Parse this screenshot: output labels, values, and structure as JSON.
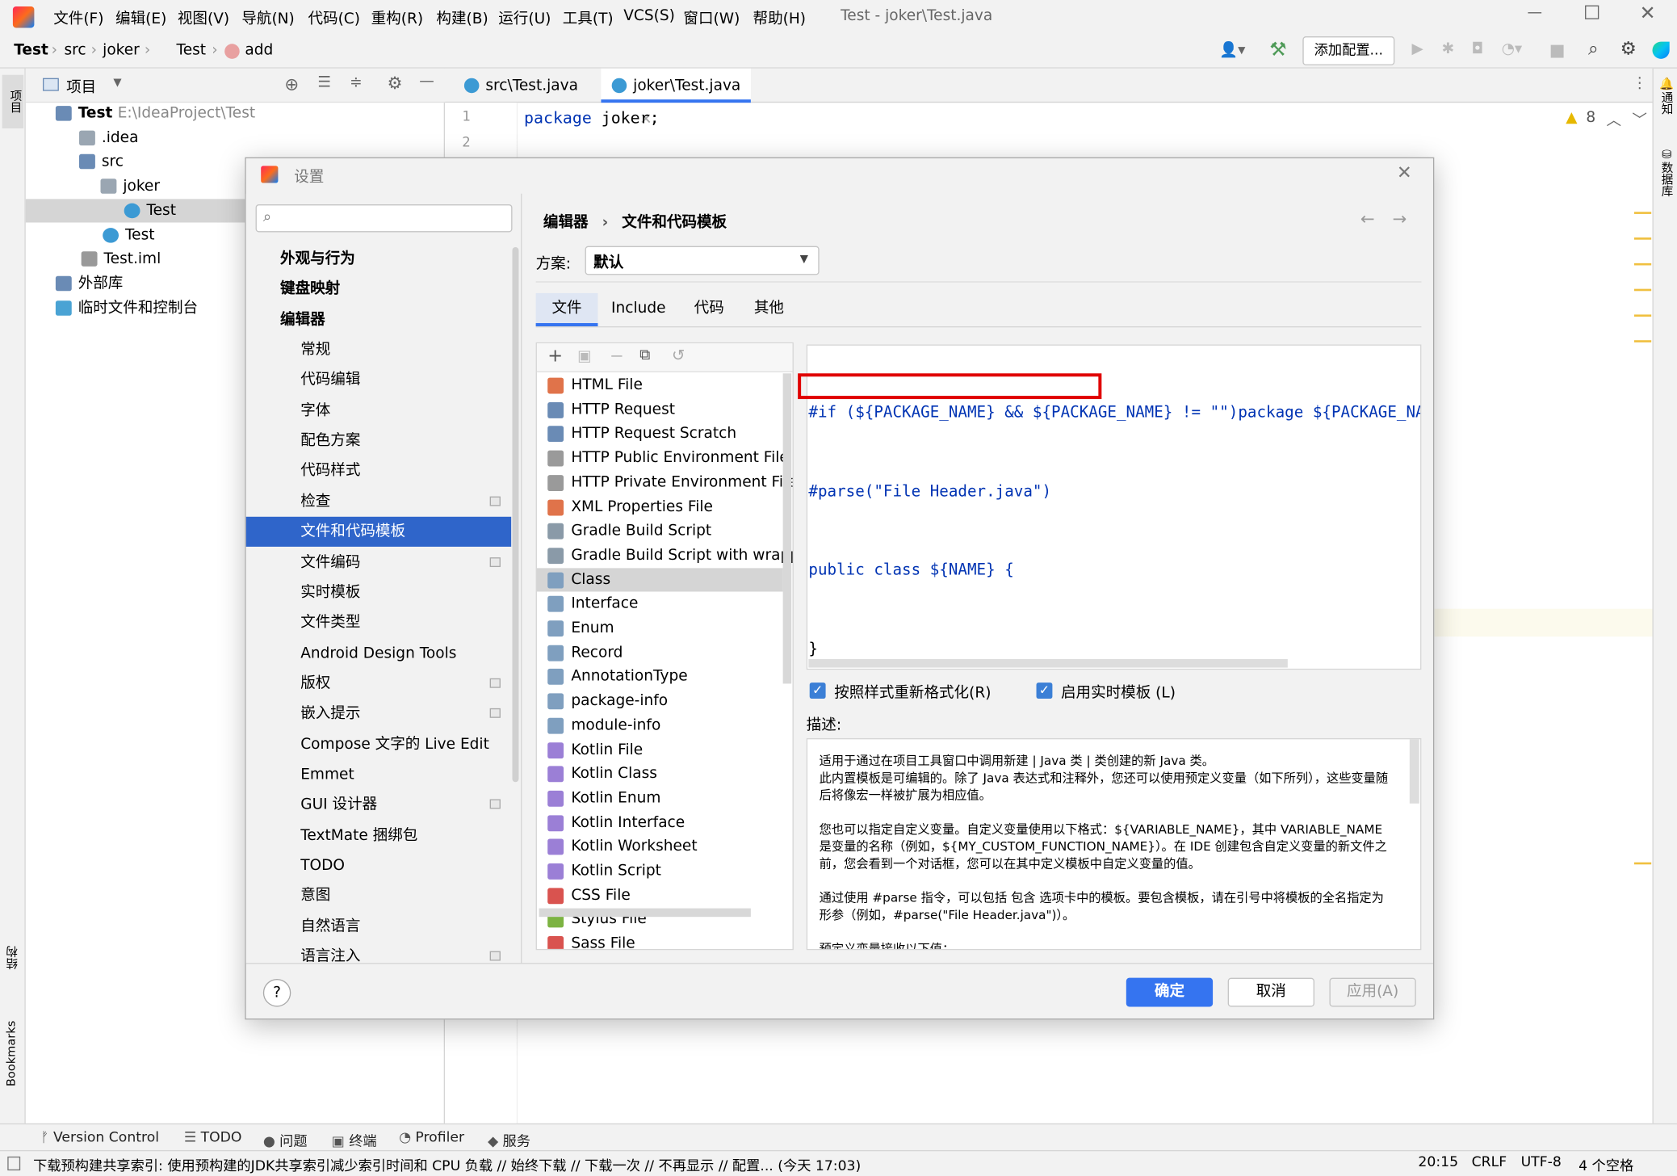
{
  "window": {
    "title": "Test - joker\\Test.java"
  },
  "menu": [
    "文件(F)",
    "编辑(E)",
    "视图(V)",
    "导航(N)",
    "代码(C)",
    "重构(R)",
    "构建(B)",
    "运行(U)",
    "工具(T)",
    "VCS(S)",
    "窗口(W)",
    "帮助(H)"
  ],
  "breadcrumb": [
    "Test",
    "src",
    "joker",
    "Test",
    "add"
  ],
  "toolbar": {
    "add_config": "添加配置..."
  },
  "project": {
    "header": "项目",
    "tree": [
      {
        "label": "Test",
        "extra": "E:\\IdeaProject\\Test"
      },
      {
        "label": ".idea"
      },
      {
        "label": "src"
      },
      {
        "label": "joker"
      },
      {
        "label": "Test"
      },
      {
        "label": "Test"
      },
      {
        "label": "Test.iml"
      },
      {
        "label": "外部库"
      },
      {
        "label": "临时文件和控制台"
      }
    ]
  },
  "editor": {
    "tabs": [
      "src\\Test.java",
      "joker\\Test.java"
    ],
    "lines": [
      "1",
      "2"
    ],
    "code": [
      "package",
      "joker;"
    ],
    "warnings": "8"
  },
  "side_labels": {
    "left_top": "项目",
    "left_structure": "结构",
    "left_bookmarks": "Bookmarks",
    "right_notify": "通知",
    "right_db": "数据库"
  },
  "dialog": {
    "title": "设置",
    "search_placeholder": "",
    "nav": [
      {
        "label": "外观与行为",
        "bold": true,
        "chev": "right",
        "indent": 0
      },
      {
        "label": "键盘映射",
        "bold": true,
        "indent": 0
      },
      {
        "label": "编辑器",
        "bold": true,
        "chev": "down",
        "indent": 0
      },
      {
        "label": "常规",
        "chev": "right",
        "indent": 1
      },
      {
        "label": "代码编辑",
        "indent": 1
      },
      {
        "label": "字体",
        "indent": 1
      },
      {
        "label": "配色方案",
        "chev": "right",
        "indent": 1
      },
      {
        "label": "代码样式",
        "chev": "right",
        "indent": 1
      },
      {
        "label": "检查",
        "indent": 1,
        "cfg": true
      },
      {
        "label": "文件和代码模板",
        "indent": 1,
        "selected": true
      },
      {
        "label": "文件编码",
        "indent": 1,
        "cfg": true
      },
      {
        "label": "实时模板",
        "indent": 1
      },
      {
        "label": "文件类型",
        "indent": 1
      },
      {
        "label": "Android Design Tools",
        "indent": 1
      },
      {
        "label": "版权",
        "chev": "right",
        "indent": 1,
        "cfg": true
      },
      {
        "label": "嵌入提示",
        "indent": 1,
        "cfg": true
      },
      {
        "label": "Compose 文字的 Live Edit",
        "indent": 1
      },
      {
        "label": "Emmet",
        "chev": "right",
        "indent": 1
      },
      {
        "label": "GUI 设计器",
        "indent": 1,
        "cfg": true
      },
      {
        "label": "TextMate 捆绑包",
        "indent": 1
      },
      {
        "label": "TODO",
        "indent": 1
      },
      {
        "label": "意图",
        "indent": 1
      },
      {
        "label": "自然语言",
        "chev": "right",
        "indent": 1
      },
      {
        "label": "语言注入",
        "chev": "right",
        "indent": 1,
        "cfg": true
      }
    ],
    "breadcrumb": [
      "编辑器",
      "文件和代码模板"
    ],
    "scheme_label": "方案:",
    "scheme_value": "默认",
    "tabs": [
      "文件",
      "Include",
      "代码",
      "其他"
    ],
    "templates": [
      {
        "label": "HTML File",
        "icon": "H",
        "color": "#e0734a"
      },
      {
        "label": "HTTP Request",
        "icon": "API",
        "color": "#6a8bb5"
      },
      {
        "label": "HTTP Request Scratch",
        "icon": "API",
        "color": "#6a8bb5"
      },
      {
        "label": "HTTP Public Environment File",
        "icon": "{}",
        "color": "#9a9a9a"
      },
      {
        "label": "HTTP Private Environment File",
        "icon": "{}",
        "color": "#9a9a9a"
      },
      {
        "label": "XML Properties File",
        "icon": "<>",
        "color": "#e0734a"
      },
      {
        "label": "Gradle Build Script",
        "icon": "G",
        "color": "#8a9aa8"
      },
      {
        "label": "Gradle Build Script with wrapper",
        "icon": "G",
        "color": "#8a9aa8"
      },
      {
        "label": "Class",
        "icon": "J",
        "color": "#7f9fbf",
        "selected": true
      },
      {
        "label": "Interface",
        "icon": "J",
        "color": "#7f9fbf"
      },
      {
        "label": "Enum",
        "icon": "J",
        "color": "#7f9fbf"
      },
      {
        "label": "Record",
        "icon": "J",
        "color": "#7f9fbf"
      },
      {
        "label": "AnnotationType",
        "icon": "J",
        "color": "#7f9fbf"
      },
      {
        "label": "package-info",
        "icon": "J",
        "color": "#7f9fbf"
      },
      {
        "label": "module-info",
        "icon": "J",
        "color": "#7f9fbf"
      },
      {
        "label": "Kotlin File",
        "icon": "K",
        "color": "#9b7fd6"
      },
      {
        "label": "Kotlin Class",
        "icon": "K",
        "color": "#9b7fd6"
      },
      {
        "label": "Kotlin Enum",
        "icon": "K",
        "color": "#9b7fd6"
      },
      {
        "label": "Kotlin Interface",
        "icon": "K",
        "color": "#9b7fd6"
      },
      {
        "label": "Kotlin Worksheet",
        "icon": "K",
        "color": "#9b7fd6"
      },
      {
        "label": "Kotlin Script",
        "icon": "K",
        "color": "#9b7fd6"
      },
      {
        "label": "CSS File",
        "icon": "CSS",
        "color": "#d9534f"
      },
      {
        "label": "Stylus File",
        "icon": "STYL",
        "color": "#7cb342"
      },
      {
        "label": "Sass File",
        "icon": "SASS",
        "color": "#d9534f"
      }
    ],
    "template_code": [
      "#if (${PACKAGE_NAME} && ${PACKAGE_NAME} != \"\")package ${PACKAGE_NAME};#end",
      "#parse(\"File Header.java\")",
      "public class ${NAME} {",
      "}"
    ],
    "reformat_label": "按照样式重新格式化(R)",
    "reformat_checked": true,
    "live_template_label": "启用实时模板 (L)",
    "live_template_checked": true,
    "desc_label": "描述:",
    "description": [
      "适用于通过在项目工具窗口中调用新建 | Java 类 | 类创建的新 Java 类。",
      "此内置模板是可编辑的。除了 Java 表达式和注释外，您还可以使用预定义变量（如下所列），这些变量随后将像宏一样被扩展为相应值。",
      "您也可以指定自定义变量。自定义变量使用以下格式：${VARIABLE_NAME}，其中 VARIABLE_NAME 是变量的名称（例如，${MY_CUSTOM_FUNCTION_NAME}）。在 IDE 创建包含自定义变量的新文件之前，您会看到一个对话框，您可以在其中定义模板中自定义变量的值。",
      "通过使用 #parse 指令，可以包括 包含 选项卡中的模板。要包含模板，请在引号中将模板的全名指定为形参（例如，#parse(\"File Header.java\")）。",
      "预定义变量接收以下值："
    ],
    "ok": "确定",
    "cancel": "取消",
    "apply": "应用(A)",
    "help": "?"
  },
  "bottom_tools": [
    "Version Control",
    "TODO",
    "问题",
    "终端",
    "Profiler",
    "服务"
  ],
  "status": {
    "message": "下载预构建共享索引: 使用预构建的JDK共享索引减少索引时间和 CPU 负载 // 始终下载 // 下载一次 // 不再显示 // 配置... (今天 17:03)",
    "position": "20:15",
    "line_sep": "CRLF",
    "encoding": "UTF-8",
    "indent": "4 个空格"
  },
  "colors": {
    "accent": "#2f65ca",
    "highlight_box": "#e00000",
    "keyword": "#0033b3",
    "variable": "#248f8f"
  }
}
